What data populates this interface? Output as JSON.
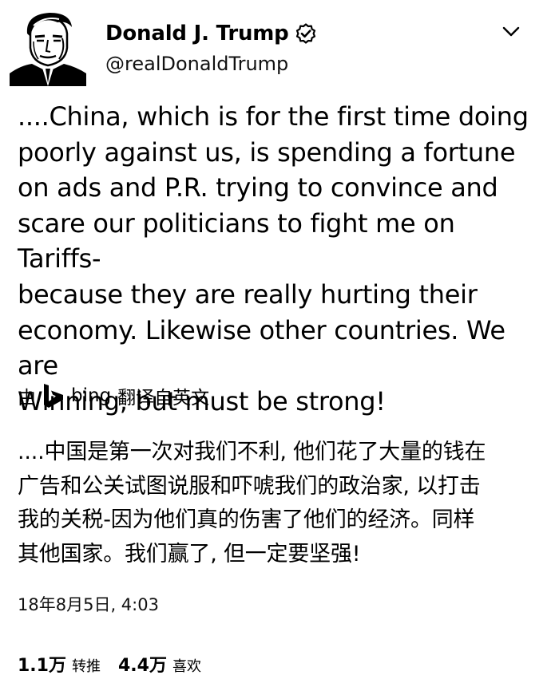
{
  "tweet": {
    "author": {
      "display_name": "Donald J. Trump",
      "handle": "@realDonaldTrump",
      "verified_icon": "verified-badge-icon",
      "avatar_icon": "avatar-portrait"
    },
    "menu_icon": "chevron-down-icon",
    "text": "....China, which is for the first time doing\npoorly against us, is spending a fortune\non ads and P.R. trying to convince and\nscare our politicians to fight me on Tariffs-\nbecause they are really hurting their\neconomy. Likewise other countries. We are\nWinning, but must be strong!",
    "translation": {
      "prefix": "由",
      "provider_icon": "bing-logo-icon",
      "provider": "bing",
      "suffix": "翻译自英文",
      "text": "....中国是第一次对我们不利, 他们花了大量的钱在\n广告和公关试图说服和吓唬我们的政治家, 以打击\n我的关税-因为他们真的伤害了他们的经济。同样\n其他国家。我们赢了, 但一定要坚强!"
    },
    "timestamp": "18年8月5日, 4:03",
    "stats": {
      "retweets_count": "1.1万",
      "retweets_label": "转推",
      "likes_count": "4.4万",
      "likes_label": "喜欢"
    },
    "colors": {
      "text": "#000000",
      "background": "#ffffff"
    }
  }
}
